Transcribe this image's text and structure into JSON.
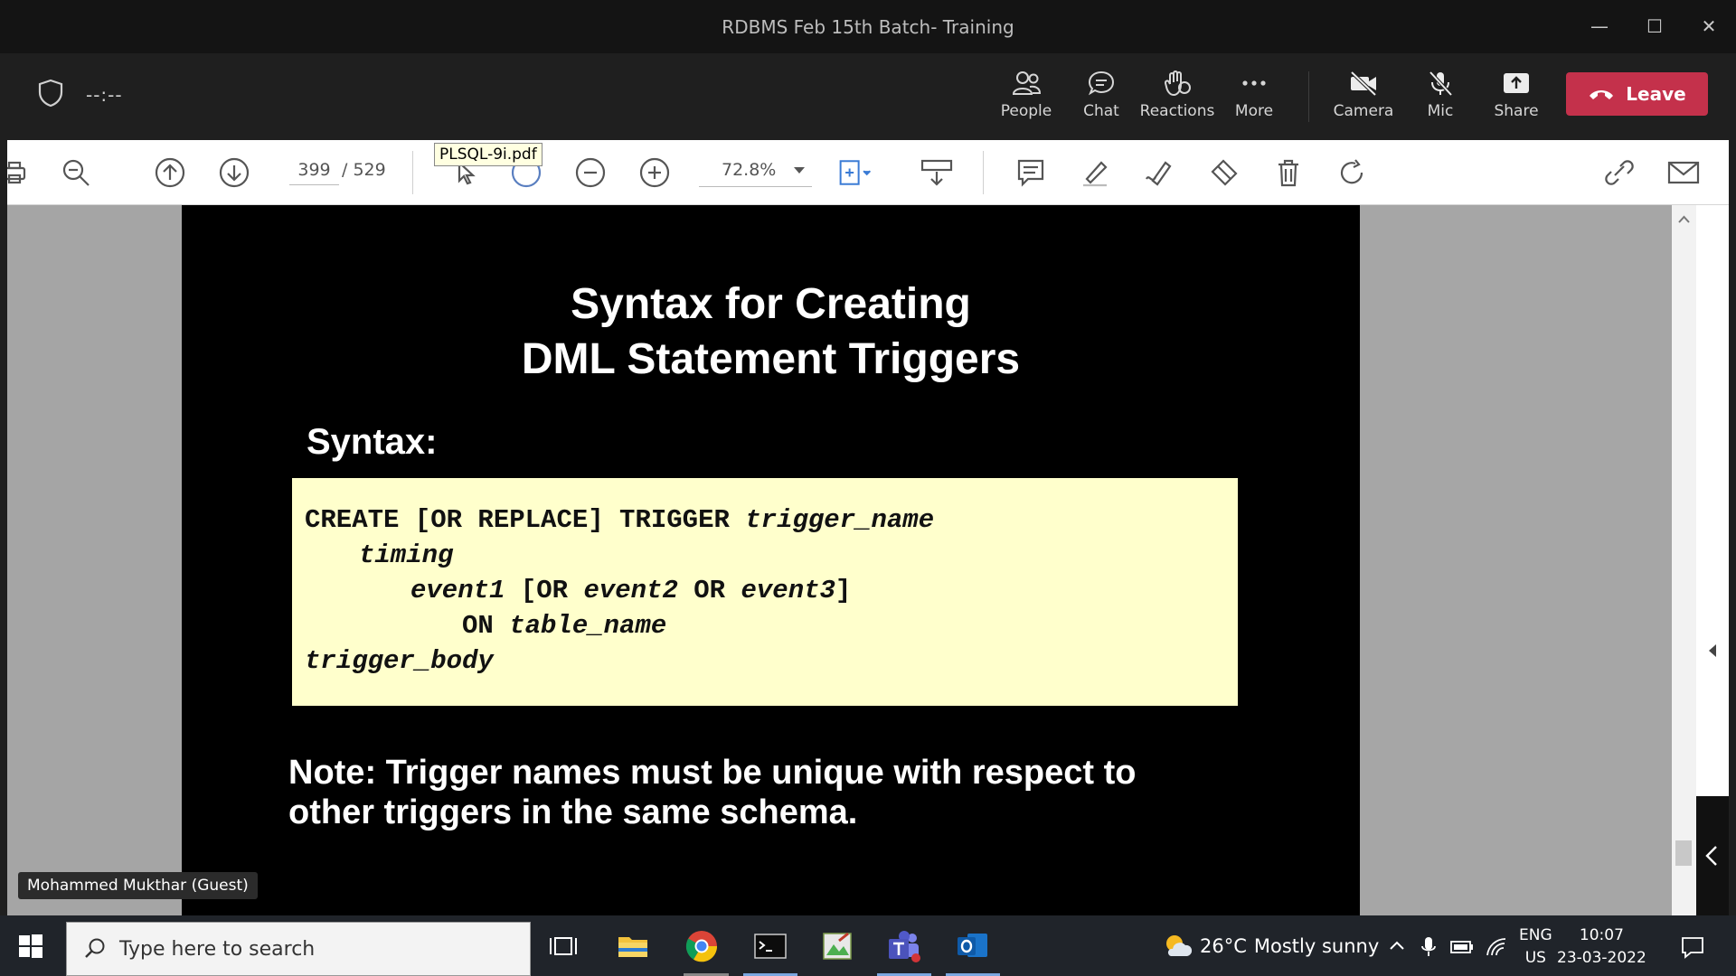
{
  "window": {
    "title": "RDBMS Feb 15th Batch- Training",
    "controls": {
      "minimize": "—",
      "maximize": "☐",
      "close": "✕"
    }
  },
  "meeting": {
    "timer": "--:--",
    "buttons": {
      "people": "People",
      "chat": "Chat",
      "reactions": "Reactions",
      "more": "More",
      "camera": "Camera",
      "mic": "Mic",
      "share": "Share"
    },
    "leave_label": "Leave",
    "leave_color": "#c4314b"
  },
  "pdf": {
    "tooltip": "PLSQL-9i.pdf",
    "current_page": "399",
    "total_pages": "/ 529",
    "zoom": "72.8%"
  },
  "slide": {
    "title_line1": "Syntax for Creating",
    "title_line2": "DML Statement Triggers",
    "syntax_label": "Syntax:",
    "code": {
      "l1_kw": "CREATE [OR REPLACE] TRIGGER ",
      "l1_it": "trigger_name",
      "l2_it": "timing",
      "l3_it1": "event1",
      "l3_kw1": " [OR ",
      "l3_it2": "event2",
      "l3_kw2": " OR ",
      "l3_it3": "event3",
      "l3_kw3": "]",
      "l4_kw": "ON ",
      "l4_it": "table_name",
      "l5_it": "trigger_body"
    },
    "note_line1": "Note: Trigger names must be unique with respect to",
    "note_line2": "other triggers in the same schema.",
    "code_bg": "#ffffcc"
  },
  "participant": {
    "name": "Mohammed Mukthar",
    "role": "(Guest)"
  },
  "taskbar": {
    "search_placeholder": "Type here to search",
    "weather_temp": "26°C",
    "weather_text": "Mostly sunny",
    "lang_top": "ENG",
    "lang_bottom": "US",
    "time": "10:07",
    "date": "23-03-2022"
  }
}
